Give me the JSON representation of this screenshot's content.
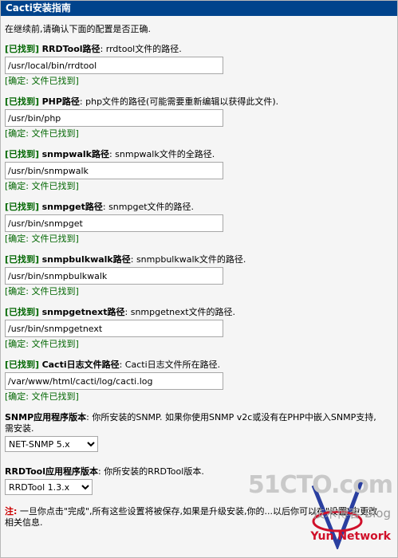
{
  "title": "Cacti安装指南",
  "intro": "在继续前,请确认下面的配置是否正确.",
  "found_tag": "[已找到]",
  "fields": [
    {
      "name": "RRDTool路径",
      "desc": ": rrdtool文件的路径.",
      "value": "/usr/local/bin/rrdtool",
      "confirm": "[确定: 文件已找到]"
    },
    {
      "name": "PHP路径",
      "desc": ": php文件的路径(可能需要重新编辑以获得此文件).",
      "value": "/usr/bin/php",
      "confirm": "[确定: 文件已找到]"
    },
    {
      "name": "snmpwalk路径",
      "desc": ": snmpwalk文件的全路径.",
      "value": "/usr/bin/snmpwalk",
      "confirm": "[确定: 文件已找到]"
    },
    {
      "name": "snmpget路径",
      "desc": ": snmpget文件的路径.",
      "value": "/usr/bin/snmpget",
      "confirm": "[确定: 文件已找到]"
    },
    {
      "name": "snmpbulkwalk路径",
      "desc": ": snmpbulkwalk文件的路径.",
      "value": "/usr/bin/snmpbulkwalk",
      "confirm": "[确定: 文件已找到]"
    },
    {
      "name": "snmpgetnext路径",
      "desc": ": snmpgetnext文件的路径.",
      "value": "/usr/bin/snmpgetnext",
      "confirm": "[确定: 文件已找到]"
    },
    {
      "name": "Cacti日志文件路径",
      "desc": ": Cacti日志文件所在路径.",
      "value": "/var/www/html/cacti/log/cacti.log",
      "confirm": "[确定: 文件已找到]"
    }
  ],
  "snmp_version": {
    "name": "SNMP应用程序版本",
    "desc": ": 你所安装的SNMP. 如果你使用SNMP v2c或没有在PHP中嵌入SNMP支持,需安装.",
    "selected": "NET-SNMP 5.x"
  },
  "rrdtool_version": {
    "name": "RRDTool应用程序版本",
    "desc": ": 你所安装的RRDTool版本.",
    "selected": "RRDTool 1.3.x"
  },
  "note": {
    "label": "注:",
    "text": " 一旦你点击\"完成\",所有这些设置将被保存,如果是升级安装,你的...以后你可以在\"设置\"中更改相关信息."
  },
  "watermark": {
    "line1": "51CTO.com",
    "line2": "技术博客 Blog",
    "line3": "Yun Network"
  }
}
